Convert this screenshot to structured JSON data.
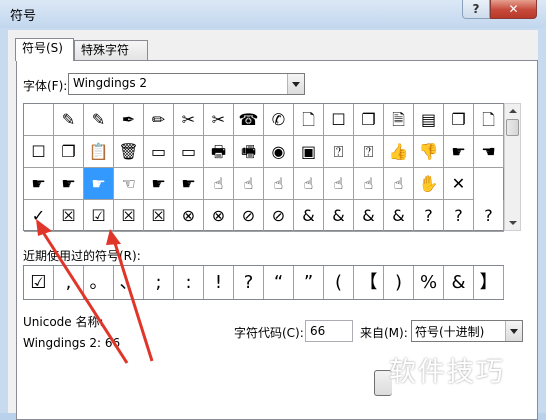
{
  "window": {
    "title": "符号",
    "help_label": "?",
    "close_label": "✕"
  },
  "tabs": [
    {
      "label": "符号(S)"
    },
    {
      "label": "特殊字符(P)"
    }
  ],
  "font": {
    "label": "字体(F):",
    "value": "Wingdings 2"
  },
  "grid": {
    "rows": [
      [
        "",
        "✎",
        "✎",
        "✒",
        "✏",
        "✂",
        "✂",
        "☎",
        "✆",
        "🗋",
        "☐",
        "❐",
        "🗎",
        "▤",
        "❐",
        "🗋"
      ],
      [
        "☐",
        "❐",
        "📋",
        "🗑",
        "▭",
        "▭",
        "🖶",
        "🖷",
        "◉",
        "▣",
        "⍰",
        "⍰",
        "👍",
        "👎",
        "☛",
        "☚"
      ],
      [
        "☛",
        "☛",
        "☛",
        "☜",
        "☛",
        "☛",
        "☝",
        "☝",
        "☝",
        "☝",
        "☝",
        "☝",
        "☝",
        "✋",
        "✕"
      ],
      [
        "✓",
        "☒",
        "☑",
        "☒",
        "☒",
        "⊗",
        "⊗",
        "⊘",
        "⊘",
        "&",
        "&",
        "&",
        "&",
        "?",
        "?",
        "?"
      ]
    ],
    "selected": {
      "row": 2,
      "col": 2
    }
  },
  "recent": {
    "label": "近期使用过的符号(R):",
    "symbols": [
      "☑",
      ",",
      "。",
      "、",
      ";",
      ":",
      "!",
      "?",
      "“",
      "”",
      "(",
      "【",
      ")",
      "%",
      "&",
      "】"
    ]
  },
  "info": {
    "unicode_label": "Unicode 名称:",
    "char_name": "Wingdings 2: 66",
    "code_label": "字符代码(C):",
    "code_value": "66",
    "from_label": "来自(M):",
    "from_value": "符号(十进制)"
  },
  "watermark": "软件技巧",
  "colors": {
    "selection": "#3399ff",
    "arrow": "#e0362a",
    "close": "#c6493a"
  }
}
